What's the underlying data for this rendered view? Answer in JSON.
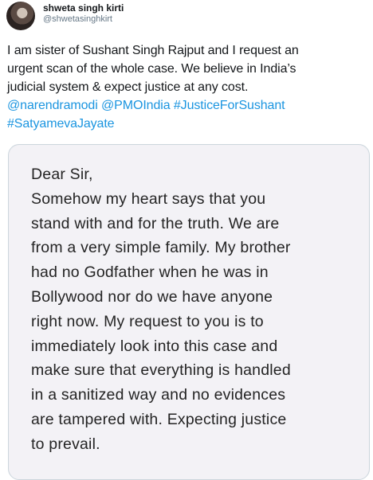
{
  "user": {
    "display_name": "shweta singh kirti",
    "handle": "@shwetasinghkirt"
  },
  "tweet": {
    "line1": "I am sister of Sushant Singh Rajput and I request an",
    "line2": "urgent scan of the whole case. We believe in India’s",
    "line3": "judicial system & expect justice at any cost.",
    "mention1": "@narendramodi",
    "mention2": "@PMOIndia",
    "hashtag1": "#JusticeForSushant",
    "hashtag2": "#SatyamevaJayate"
  },
  "letter": {
    "lines": [
      "Dear Sir,",
      "Somehow my heart says that you",
      "stand with and for the truth. We are",
      "from a very simple family. My brother",
      "had no Godfather when he was in",
      "Bollywood nor do we have anyone",
      "right now. My request to you is to",
      "immediately look into this case and",
      "make sure that everything is handled",
      "in a sanitized way and no evidences",
      "are tampered with.  Expecting justice",
      "to prevail."
    ]
  }
}
